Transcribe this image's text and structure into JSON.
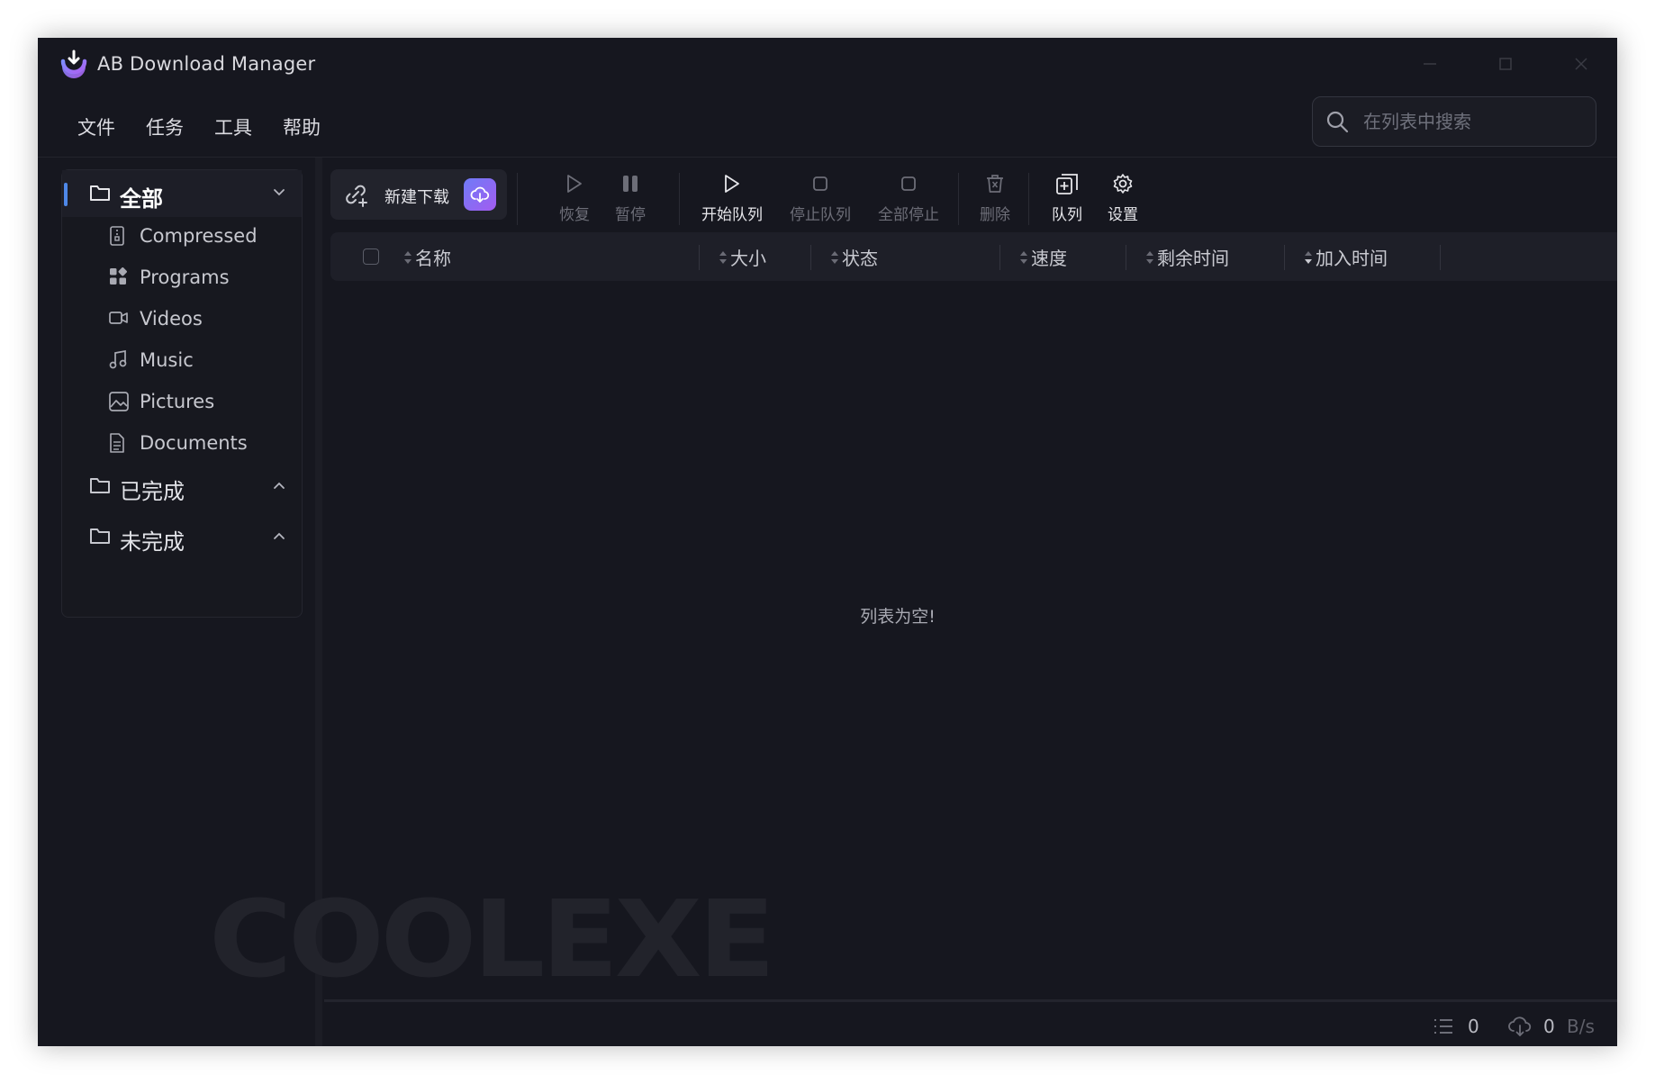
{
  "window": {
    "title": "AB Download Manager"
  },
  "menubar": {
    "items": [
      "文件",
      "任务",
      "工具",
      "帮助"
    ]
  },
  "search": {
    "placeholder": "在列表中搜索",
    "value": ""
  },
  "sidebar": {
    "categories": [
      {
        "label": "全部",
        "icon": "folder-icon",
        "expanded": true,
        "active": true
      },
      {
        "label": "已完成",
        "icon": "folder-icon",
        "expanded": false,
        "active": false
      },
      {
        "label": "未完成",
        "icon": "folder-icon",
        "expanded": false,
        "active": false
      }
    ],
    "subcategories": [
      {
        "label": "Compressed",
        "icon": "archive-icon"
      },
      {
        "label": "Programs",
        "icon": "apps-icon"
      },
      {
        "label": "Videos",
        "icon": "video-icon"
      },
      {
        "label": "Music",
        "icon": "music-icon"
      },
      {
        "label": "Pictures",
        "icon": "picture-icon"
      },
      {
        "label": "Documents",
        "icon": "document-icon"
      }
    ]
  },
  "toolbar": {
    "new_download": "新建下载",
    "resume": "恢复",
    "pause": "暂停",
    "start_queue": "开始队列",
    "stop_queue": "停止队列",
    "stop_all": "全部停止",
    "delete": "删除",
    "queue": "队列",
    "settings": "设置"
  },
  "table": {
    "columns": [
      "名称",
      "大小",
      "状态",
      "速度",
      "剩余时间",
      "加入时间"
    ],
    "rows": [],
    "empty_message": "列表为空!"
  },
  "statusbar": {
    "active_count": "0",
    "speed_value": "0",
    "speed_unit": "B/s"
  },
  "watermark": {
    "text": "COOLEXE"
  },
  "colors": {
    "background": "#16171f",
    "accent": "#4e88e8",
    "cloud_gradient_start": "#6f7bf7",
    "cloud_gradient_end": "#a35cf0",
    "disabled_text": "#6d6e78"
  }
}
